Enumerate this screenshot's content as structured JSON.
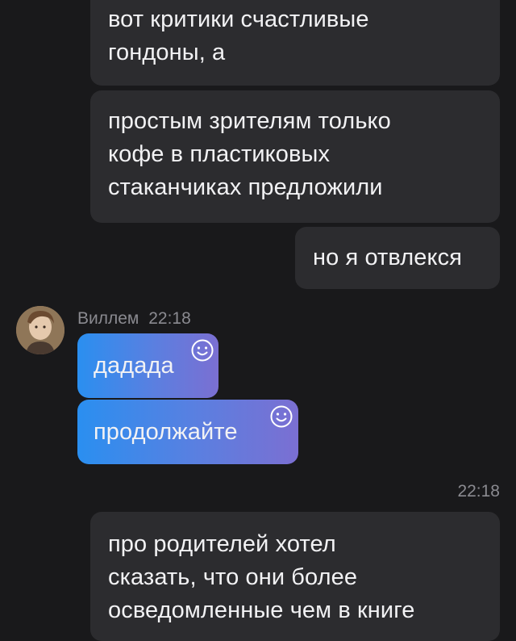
{
  "messages": {
    "m1": {
      "lines": [
        "вот критики счастливые",
        "гондоны, а"
      ]
    },
    "m2": {
      "lines": [
        "простым зрителям только",
        "кофе в пластиковых",
        "стаканчиках предложили"
      ]
    },
    "m3": {
      "text": "но я отвлекся"
    },
    "incoming": {
      "sender": "Виллем",
      "time": "22:18",
      "m4": {
        "text": "дадада"
      },
      "m5": {
        "text": "продолжайте"
      }
    },
    "divider_time": "22:18",
    "m6": {
      "lines": [
        "про родителей хотел",
        "сказать, что они более",
        "осведомленные чем в книге"
      ]
    }
  },
  "colors": {
    "background": "#19191b",
    "outgoing_bubble": "#2c2c2f",
    "incoming_gradient_start": "#2a8ff0",
    "incoming_gradient_end": "#7b6fd2",
    "meta_text": "#8a8a90"
  },
  "icons": {
    "reaction": "smiley-icon"
  }
}
